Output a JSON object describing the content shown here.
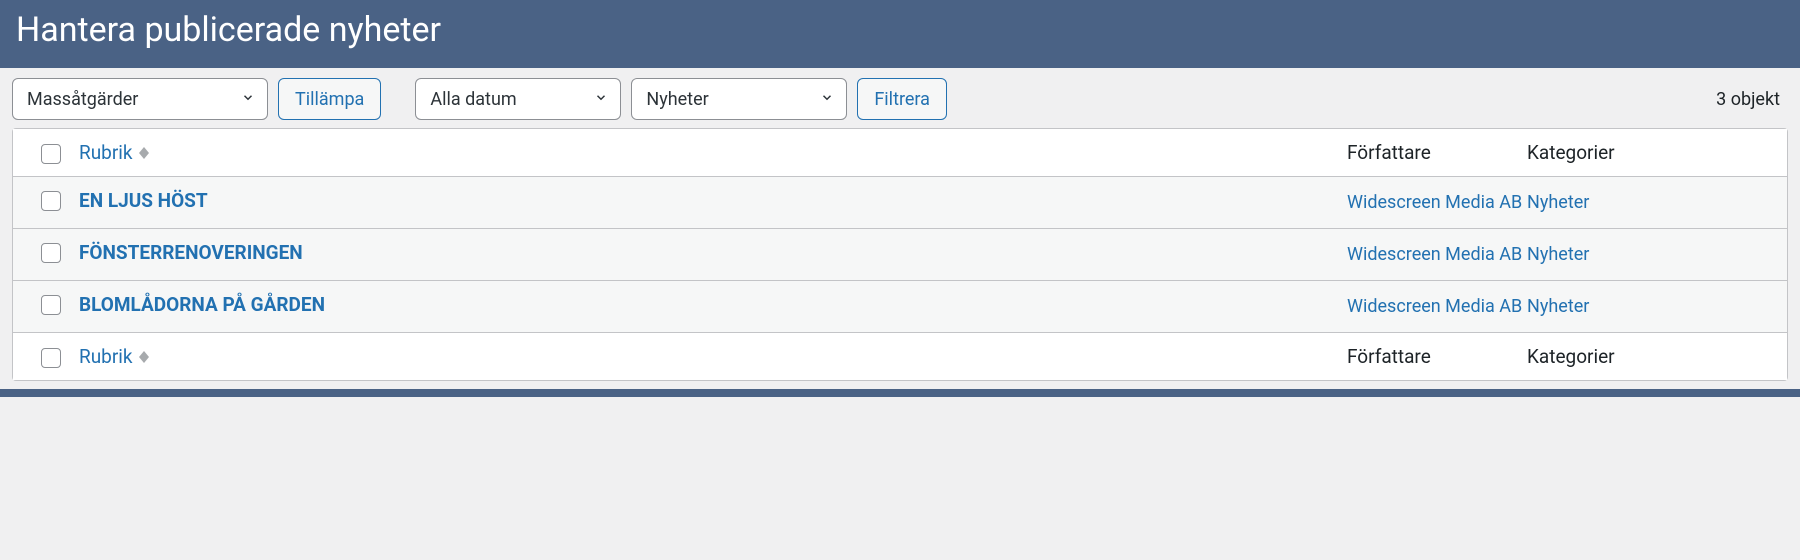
{
  "header": {
    "title": "Hantera publicerade nyheter"
  },
  "toolbar": {
    "bulk_actions_selected": "Massåtgärder",
    "apply_label": "Tillämpa",
    "date_selected": "Alla datum",
    "category_selected": "Nyheter",
    "filter_label": "Filtrera",
    "count_text": "3 objekt"
  },
  "columns": {
    "title": "Rubrik",
    "author": "Författare",
    "categories": "Kategorier"
  },
  "rows": [
    {
      "title": "EN LJUS HÖST",
      "author": "Widescreen Media AB",
      "categories": "Nyheter"
    },
    {
      "title": "FÖNSTERRENOVERINGEN",
      "author": "Widescreen Media AB",
      "categories": "Nyheter"
    },
    {
      "title": "BLOMLÅDORNA PÅ GÅRDEN",
      "author": "Widescreen Media AB",
      "categories": "Nyheter"
    }
  ]
}
